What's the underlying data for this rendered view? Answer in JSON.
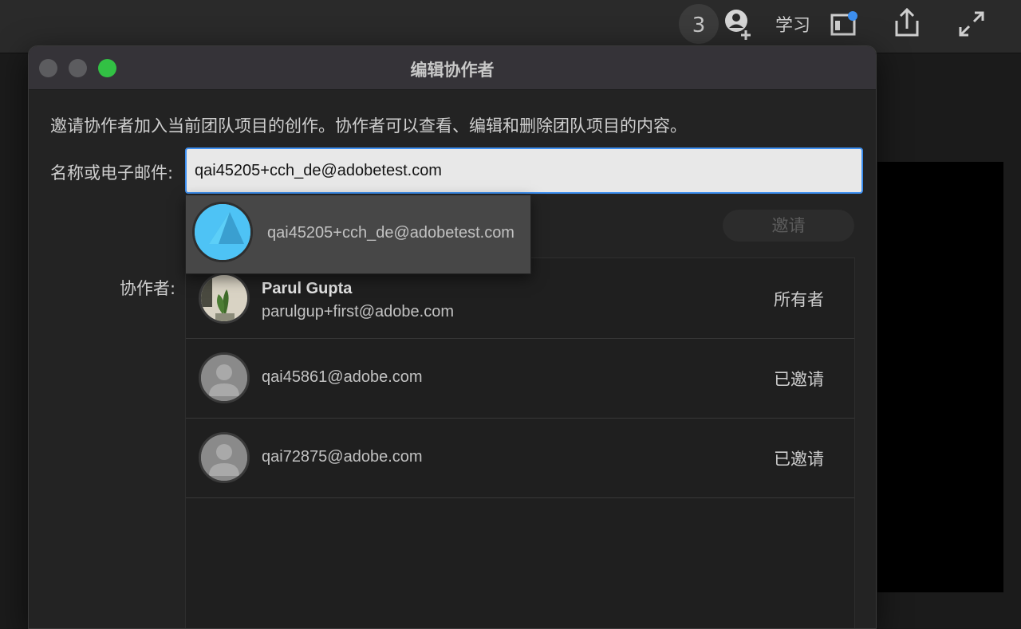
{
  "topbar": {
    "notification_count": "3",
    "learn_label": "学习",
    "icons": [
      "add-user-icon",
      "panel-icon",
      "share-icon",
      "expand-icon"
    ]
  },
  "dialog": {
    "title": "编辑协作者",
    "description": "邀请协作者加入当前团队项目的创作。协作者可以查看、编辑和删除团队项目的内容。",
    "name_label": "名称或电子邮件:",
    "input_value": "qai45205+cch_de@adobetest.com",
    "invite_label": "邀请",
    "collaborators_label": "协作者:",
    "suggestion": {
      "email": "qai45205+cch_de@adobetest.com"
    },
    "collaborators": [
      {
        "name": "Parul Gupta",
        "email": "parulgup+first@adobe.com",
        "role": "所有者"
      },
      {
        "name": "",
        "email": "qai45861@adobe.com",
        "role": "已邀请"
      },
      {
        "name": "",
        "email": "qai72875@adobe.com",
        "role": "已邀请"
      }
    ]
  },
  "colors": {
    "accent": "#3d8ff0",
    "maximize": "#32c144",
    "suggest_avatar": "#4ec3f5"
  }
}
